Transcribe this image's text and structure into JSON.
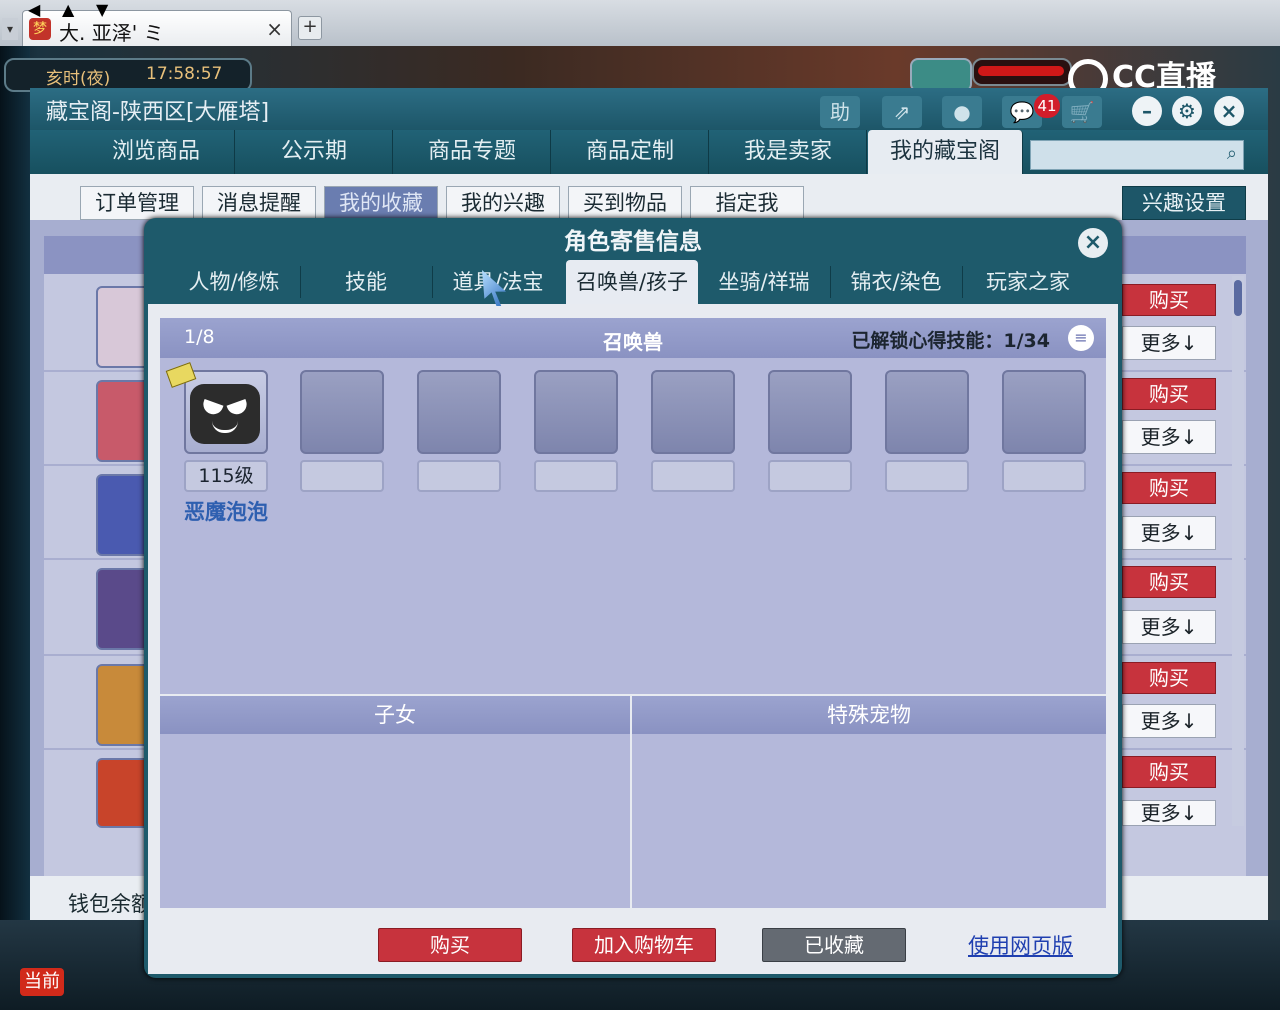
{
  "browser": {
    "tab_title": "大. 亚泽' ミ",
    "tab_close": "×",
    "new_tab": "+",
    "tab_menu": "▾"
  },
  "game_overlay": {
    "time_label": "亥时(夜)",
    "clock": "17:58:57",
    "stream_logo": "CC直播",
    "current_button": "当前"
  },
  "window": {
    "title": "藏宝阁-陕西区[大雁塔]",
    "toolbar": {
      "help": "助",
      "share": "⇗",
      "record": "●",
      "chat": "💬",
      "cart": "🛒",
      "minimize": "–",
      "settings": "⚙",
      "close": "×"
    },
    "message_count": "41",
    "nav_tabs": [
      "浏览商品",
      "公示期",
      "商品专题",
      "商品定制",
      "我是卖家",
      "我的藏宝阁"
    ],
    "search_icon": "⌕",
    "sub_tabs": [
      "订单管理",
      "消息提醒",
      "我的收藏",
      "我的兴趣",
      "买到物品",
      "指定我"
    ],
    "interest_settings": "兴趣设置",
    "row_buy": "购买",
    "row_more": "更多↓",
    "wallet_label": "钱包余额"
  },
  "modal": {
    "title": "角色寄售信息",
    "close": "×",
    "tabs": [
      "人物/修炼",
      "技能",
      "道具/法宝",
      "召唤兽/孩子",
      "坐骑/祥瑞",
      "锦衣/染色",
      "玩家之家"
    ],
    "pets": {
      "count": "1/8",
      "title": "召唤兽",
      "skills_label": "已解锁心得技能：1/34",
      "list_icon": "≡",
      "first_level": "115级",
      "first_name": "恶魔泡泡"
    },
    "children_title": "子女",
    "special_pets_title": "特殊宠物",
    "buttons": {
      "buy": "购买",
      "add_cart": "加入购物车",
      "favorited": "已收藏",
      "web_version": "使用网页版"
    }
  },
  "colors": {
    "accent": "#1d5668",
    "buy_red": "#c7333d",
    "panel": "#b4b8da",
    "link": "#1f3fb0"
  }
}
